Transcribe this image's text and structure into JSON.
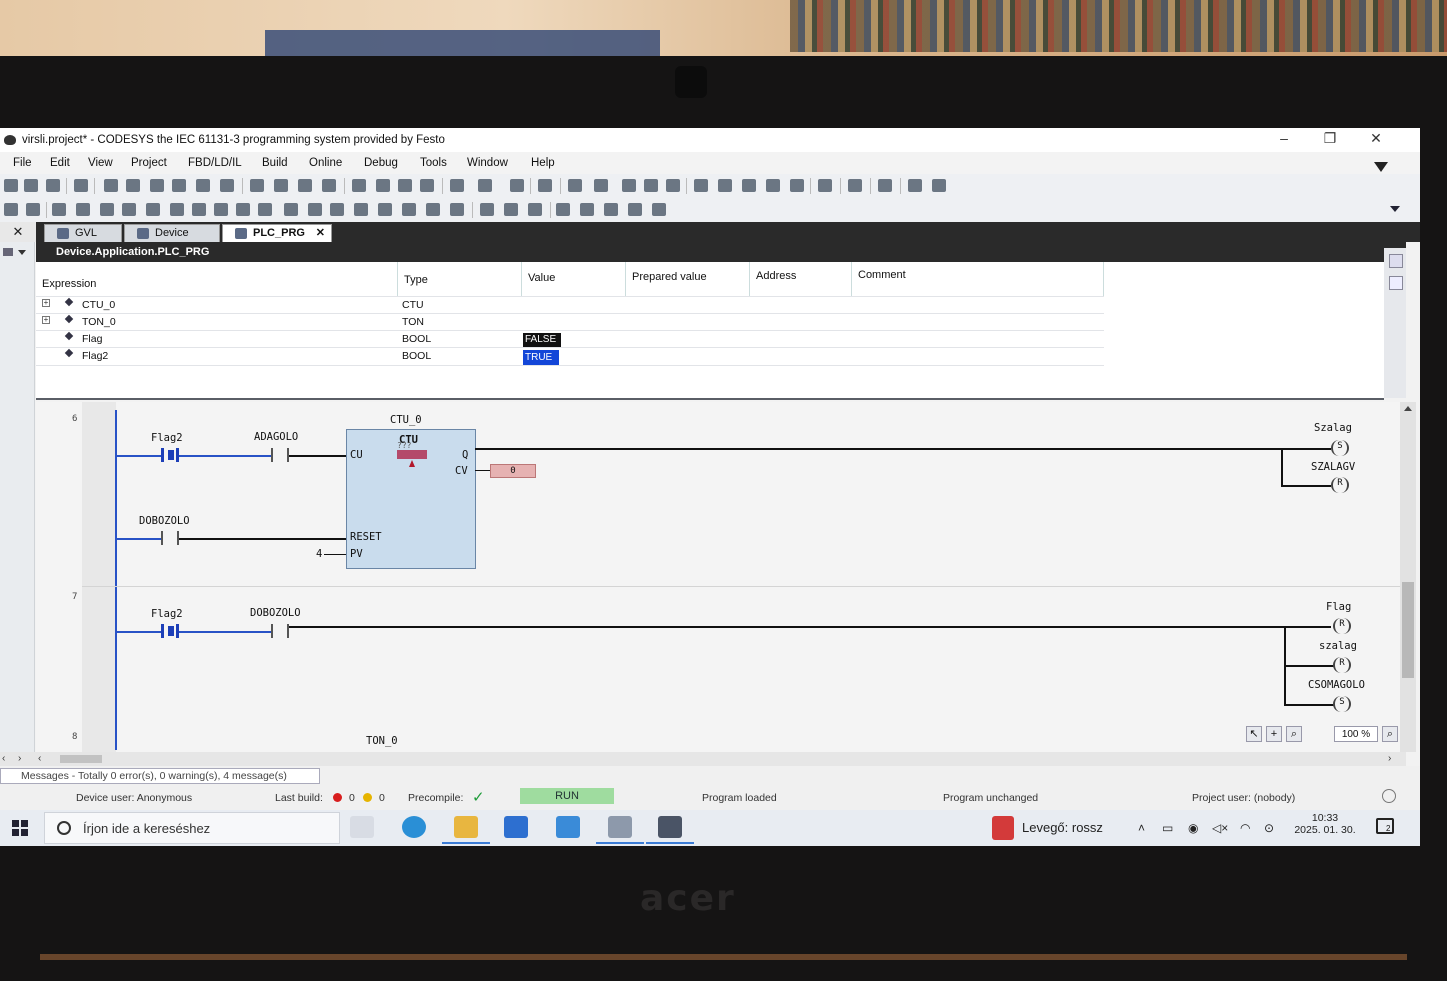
{
  "window": {
    "title": "virsli.project* - CODESYS the IEC 61131-3 programming system provided by Festo",
    "controls": [
      "–",
      "❐",
      "✕"
    ]
  },
  "menu": [
    "File",
    "Edit",
    "View",
    "Project",
    "FBD/LD/IL",
    "Build",
    "Online",
    "Debug",
    "Tools",
    "Window",
    "Help"
  ],
  "tabs": [
    {
      "label": "GVL",
      "icon": "globe-icon"
    },
    {
      "label": "Device",
      "icon": "device-icon"
    },
    {
      "label": "PLC_PRG",
      "icon": "program-icon",
      "active": true,
      "close": "✕"
    }
  ],
  "left_close": "✕",
  "watch": {
    "path": "Device.Application.PLC_PRG",
    "columns": [
      "Expression",
      "Type",
      "Value",
      "Prepared value",
      "Address",
      "Comment"
    ],
    "rows": [
      {
        "expression": "CTU_0",
        "type": "CTU",
        "value": "",
        "expandable": true
      },
      {
        "expression": "TON_0",
        "type": "TON",
        "value": "",
        "expandable": true
      },
      {
        "expression": "Flag",
        "type": "BOOL",
        "value": "FALSE"
      },
      {
        "expression": "Flag2",
        "type": "BOOL",
        "value": "TRUE"
      }
    ]
  },
  "ladder": {
    "networks": [
      {
        "number": "6",
        "instance": "CTU_0",
        "block_type": "CTU",
        "block_mark": "???",
        "inputs": [
          "CU",
          "RESET",
          "PV"
        ],
        "outputs": [
          "Q",
          "CV"
        ],
        "pv_value": "4",
        "cv_value": "0",
        "contacts": [
          "Flag2",
          "ADAGOLO",
          "DOBOZOLO"
        ],
        "coils": [
          {
            "name": "Szalag",
            "type": "S"
          },
          {
            "name": "SZALAGV",
            "type": "R"
          }
        ]
      },
      {
        "number": "7",
        "contacts": [
          "Flag2",
          "DOBOZOLO"
        ],
        "coils": [
          {
            "name": "Flag",
            "type": "R"
          },
          {
            "name": "szalag",
            "type": "R"
          },
          {
            "name": "CSOMAGOLO",
            "type": "S"
          }
        ]
      },
      {
        "number": "8",
        "instance": "TON_0"
      }
    ],
    "zoom": "100 %"
  },
  "messages": "Messages - Totally 0 error(s), 0 warning(s), 4 message(s)",
  "status": {
    "device_user": "Device user: Anonymous",
    "last_build_label": "Last build:",
    "errors": "0",
    "warnings": "0",
    "precompile_label": "Precompile:",
    "run": "RUN",
    "program_loaded": "Program loaded",
    "program_unchanged": "Program unchanged",
    "project_user": "Project user: (nobody)"
  },
  "taskbar": {
    "search_placeholder": "Írjon ide a kereséshez",
    "weather": "Levegő: rossz",
    "time": "10:33",
    "date": "2025. 01. 30.",
    "notifications": "2"
  },
  "brand": "acer",
  "colors": {
    "true_value": "#1346d8",
    "false_value": "#111111",
    "run_status": "#9fdc9f",
    "rail": "#2852c6",
    "block": "#c9dced"
  }
}
